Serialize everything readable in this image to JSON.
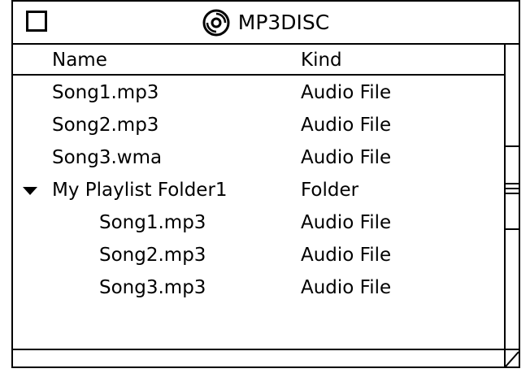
{
  "window": {
    "title": "MP3DISC",
    "title_icon": "disc-icon"
  },
  "columns": {
    "name": "Name",
    "kind": "Kind"
  },
  "rows": [
    {
      "name": "Song1.mp3",
      "kind": "Audio File",
      "level": 0,
      "expanded": null
    },
    {
      "name": "Song2.mp3",
      "kind": "Audio File",
      "level": 0,
      "expanded": null
    },
    {
      "name": "Song3.wma",
      "kind": "Audio File",
      "level": 0,
      "expanded": null
    },
    {
      "name": "My Playlist Folder1",
      "kind": "Folder",
      "level": 0,
      "expanded": true
    },
    {
      "name": "Song1.mp3",
      "kind": "Audio File",
      "level": 1,
      "expanded": null
    },
    {
      "name": "Song2.mp3",
      "kind": "Audio File",
      "level": 1,
      "expanded": null
    },
    {
      "name": "Song3.mp3",
      "kind": "Audio File",
      "level": 1,
      "expanded": null
    }
  ]
}
